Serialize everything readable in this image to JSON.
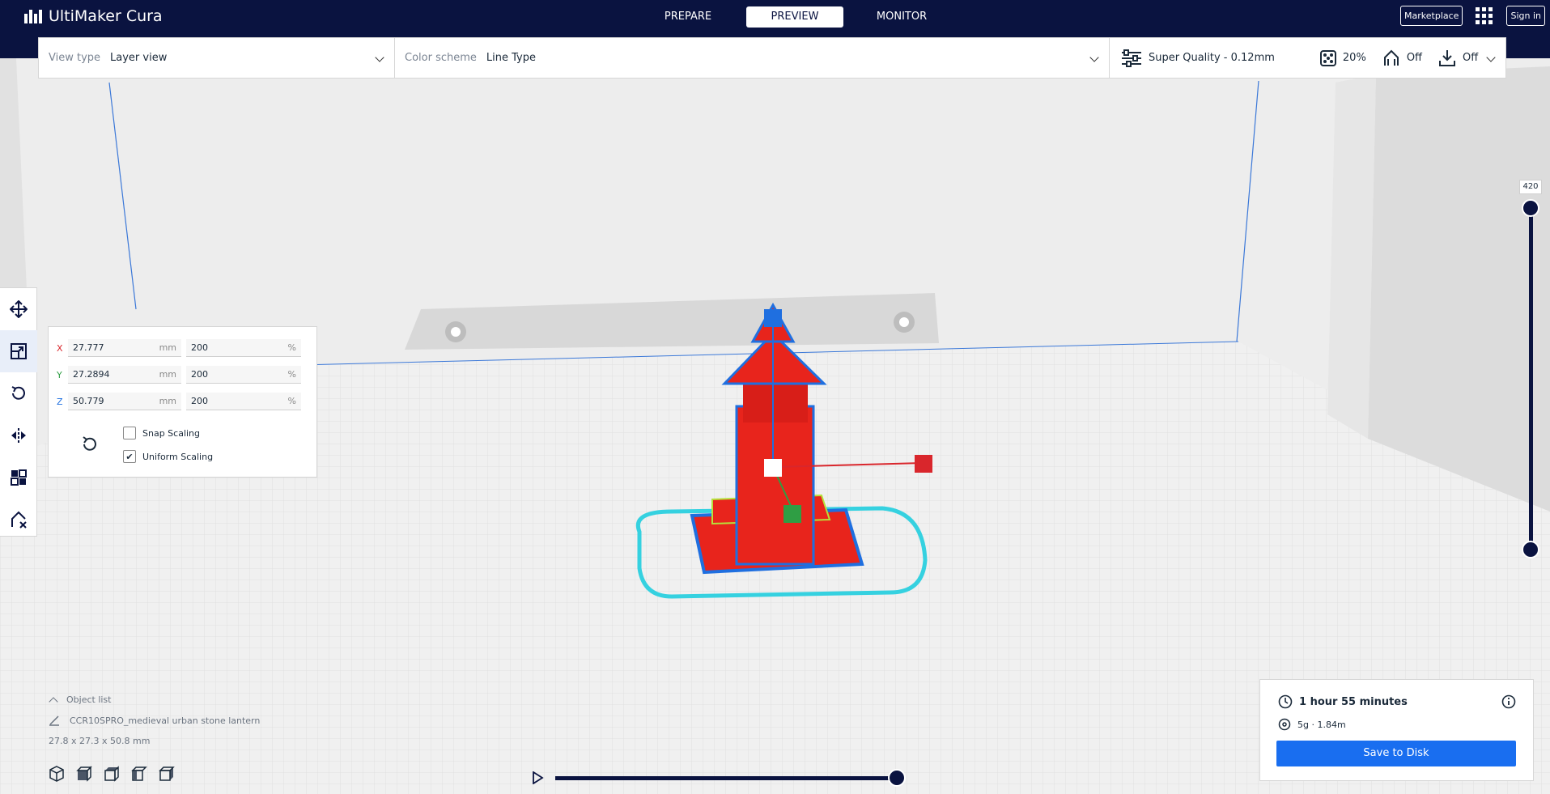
{
  "app": {
    "title": "UltiMaker Cura"
  },
  "stages": [
    {
      "label": "PREPARE",
      "active": false
    },
    {
      "label": "PREVIEW",
      "active": true
    },
    {
      "label": "MONITOR",
      "active": false
    }
  ],
  "topbar": {
    "marketplace": "Marketplace",
    "signin": "Sign in"
  },
  "header": {
    "view_type_label": "View type",
    "view_type_value": "Layer view",
    "color_scheme_label": "Color scheme",
    "color_scheme_value": "Line Type",
    "quality": "Super Quality - 0.12mm",
    "infill": "20%",
    "support": "Off",
    "adhesion": "Off"
  },
  "scale": {
    "x": {
      "axis": "X",
      "value": "27.777",
      "unit": "mm",
      "percent": "200",
      "pct_unit": "%"
    },
    "y": {
      "axis": "Y",
      "value": "27.2894",
      "unit": "mm",
      "percent": "200",
      "pct_unit": "%"
    },
    "z": {
      "axis": "Z",
      "value": "50.779",
      "unit": "mm",
      "percent": "200",
      "pct_unit": "%"
    },
    "snap_label": "Snap Scaling",
    "snap_checked": false,
    "uniform_label": "Uniform Scaling",
    "uniform_checked": true
  },
  "layer_slider": {
    "max_layer": "420"
  },
  "object_list": {
    "header": "Object list",
    "object_name": "CCR10SPRO_medieval urban stone lantern",
    "dimensions": "27.8 x 27.3 x 50.8 mm"
  },
  "print_info": {
    "time": "1 hour 55 minutes",
    "material": "5g · 1.84m",
    "save_label": "Save to Disk"
  },
  "colors": {
    "topbar": "#0a1340",
    "accent": "#196ef0",
    "model_red": "#e8241c",
    "x_axis": "#d9262c",
    "y_axis": "#2f9e44",
    "z_axis": "#1f6fe0"
  }
}
